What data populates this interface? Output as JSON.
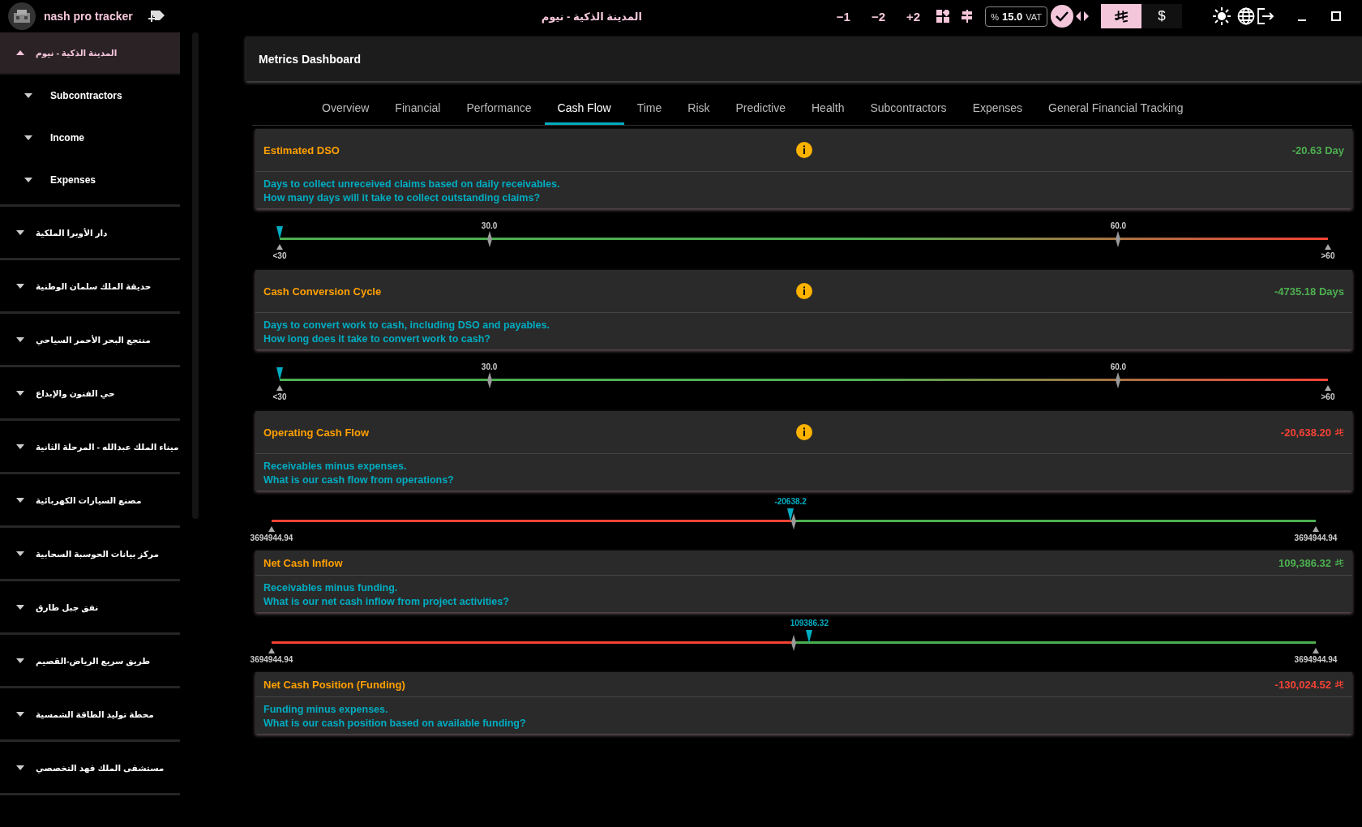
{
  "app": {
    "name": "nash pro tracker",
    "title": "المدينة الذكية - نيوم"
  },
  "toolbar": {
    "steps": [
      "−1",
      "−2",
      "+2"
    ],
    "vat": {
      "prefix": "%",
      "value": "15.0",
      "suffix": "VAT"
    },
    "currencies": [
      {
        "kind": "riyal",
        "selected": true
      },
      {
        "kind": "dollar",
        "label": "$",
        "selected": false
      }
    ]
  },
  "sidebar": {
    "items": [
      {
        "label": "المدينة الذكية - نيوم",
        "expanded": true,
        "selected": true,
        "children": [
          {
            "label": "Subcontractors",
            "expanded": false
          },
          {
            "label": "Income",
            "expanded": false
          },
          {
            "label": "Expenses",
            "expanded": false
          }
        ]
      },
      {
        "label": "دار الأوبرا الملكية",
        "expanded": false,
        "selected": false
      },
      {
        "label": "حديقة الملك سلمان الوطنية",
        "expanded": false,
        "selected": false
      },
      {
        "label": "منتجع البحر الأحمر السياحي",
        "expanded": false,
        "selected": false
      },
      {
        "label": "حي الفنون والإبداع",
        "expanded": false,
        "selected": false
      },
      {
        "label": "ميناء الملك عبدالله - المرحلة الثانية",
        "expanded": false,
        "selected": false
      },
      {
        "label": "مصنع السيارات الكهربائية",
        "expanded": false,
        "selected": false
      },
      {
        "label": "مركز بيانات الحوسبة السحابية",
        "expanded": false,
        "selected": false
      },
      {
        "label": "نفق جبل طارق",
        "expanded": false,
        "selected": false
      },
      {
        "label": "طريق سريع الرياض-القصيم",
        "expanded": false,
        "selected": false
      },
      {
        "label": "محطة توليد الطاقة الشمسية",
        "expanded": false,
        "selected": false
      },
      {
        "label": "مستشفى الملك فهد التخصصي",
        "expanded": false,
        "selected": false
      }
    ]
  },
  "dashboard": {
    "title": "Metrics Dashboard",
    "tabs": [
      {
        "label": "Overview",
        "selected": false
      },
      {
        "label": "Financial",
        "selected": false
      },
      {
        "label": "Performance",
        "selected": false
      },
      {
        "label": "Cash Flow",
        "selected": true
      },
      {
        "label": "Time",
        "selected": false
      },
      {
        "label": "Risk",
        "selected": false
      },
      {
        "label": "Predictive",
        "selected": false
      },
      {
        "label": "Health",
        "selected": false
      },
      {
        "label": "Subcontractors",
        "selected": false
      },
      {
        "label": "Expenses",
        "selected": false
      },
      {
        "label": "General Financial Tracking",
        "selected": false
      }
    ],
    "metrics": [
      {
        "title": "Estimated DSO",
        "info": true,
        "value": "-20.63 Day",
        "color": "#4caf50",
        "currency": false,
        "lines": [
          "Days to collect unreceived claims based on daily receivables.",
          "How many days will it take to collect outstanding claims?"
        ],
        "gauge": {
          "kind": "threshold",
          "level": 0,
          "ticks": [
            "30.0",
            "60.0"
          ],
          "start": "<30",
          "end": ">60"
        }
      },
      {
        "title": "Cash Conversion Cycle",
        "info": true,
        "value": "-4735.18 Days",
        "color": "#4caf50",
        "currency": false,
        "lines": [
          "Days to convert work to cash, including DSO and payables.",
          "How long does it take to convert work to cash?"
        ],
        "gauge": {
          "kind": "threshold",
          "level": 0,
          "ticks": [
            "30.0",
            "60.0"
          ],
          "start": "<30",
          "end": ">60"
        }
      },
      {
        "title": "Operating Cash Flow",
        "info": true,
        "value": "-20,638.20",
        "color": "#f44336",
        "currency": true,
        "lines": [
          "Receivables minus expenses.",
          "What is our cash flow from operations?"
        ],
        "gauge": {
          "kind": "diverging",
          "level": 0.497,
          "reading": "-20638.2",
          "start": "3694944.94",
          "end": "3694944.94"
        }
      },
      {
        "title": "Net Cash Inflow",
        "info": false,
        "value": "109,386.32",
        "color": "#4caf50",
        "currency": true,
        "lines": [
          "Receivables minus funding.",
          "What is our net cash inflow from project activities?"
        ],
        "gauge": {
          "kind": "diverging",
          "level": 0.515,
          "reading": "109386.32",
          "start": "3694944.94",
          "end": "3694944.94"
        }
      },
      {
        "title": "Net Cash Position (Funding)",
        "info": false,
        "value": "-130,024.52",
        "color": "#f44336",
        "currency": true,
        "lines": [
          "Funding minus expenses.",
          "What is our cash position based on available funding?"
        ]
      }
    ]
  }
}
